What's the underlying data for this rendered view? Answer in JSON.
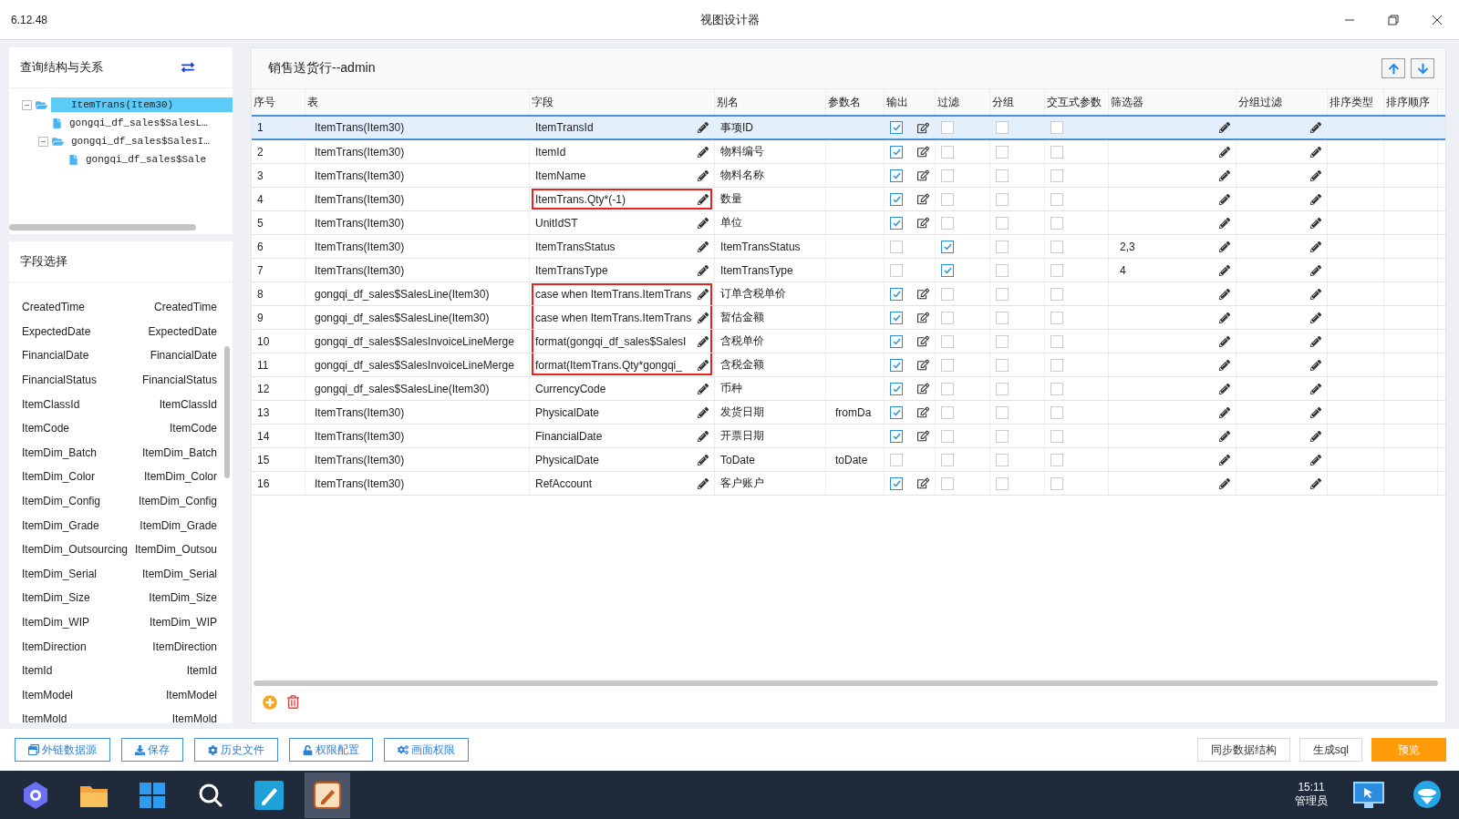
{
  "window": {
    "version": "6.12.48",
    "title": "视图设计器"
  },
  "structure": {
    "title": "查询结构与关系",
    "tree": [
      {
        "label": "ItemTrans(Item30)",
        "selected": true,
        "expanded": true,
        "kind": "folder",
        "children": [
          {
            "label": "gongqi_df_sales$SalesL…",
            "selected": false,
            "kind": "file"
          },
          {
            "label": "gongqi_df_sales$SalesI…",
            "selected": false,
            "expanded": true,
            "kind": "folder",
            "children": [
              {
                "label": "gongqi_df_sales$Sale",
                "selected": false,
                "kind": "file"
              }
            ]
          }
        ]
      }
    ]
  },
  "field_select": {
    "title": "字段选择",
    "fields": [
      {
        "name": "CreatedTime",
        "alias": "CreatedTime"
      },
      {
        "name": "ExpectedDate",
        "alias": "ExpectedDate"
      },
      {
        "name": "FinancialDate",
        "alias": "FinancialDate"
      },
      {
        "name": "FinancialStatus",
        "alias": "FinancialStatus"
      },
      {
        "name": "ItemClassId",
        "alias": "ItemClassId"
      },
      {
        "name": "ItemCode",
        "alias": "ItemCode"
      },
      {
        "name": "ItemDim_Batch",
        "alias": "ItemDim_Batch"
      },
      {
        "name": "ItemDim_Color",
        "alias": "ItemDim_Color"
      },
      {
        "name": "ItemDim_Config",
        "alias": "ItemDim_Config"
      },
      {
        "name": "ItemDim_Grade",
        "alias": "ItemDim_Grade"
      },
      {
        "name": "ItemDim_Outsourcing",
        "alias": "ItemDim_Outsou"
      },
      {
        "name": "ItemDim_Serial",
        "alias": "ItemDim_Serial"
      },
      {
        "name": "ItemDim_Size",
        "alias": "ItemDim_Size"
      },
      {
        "name": "ItemDim_WIP",
        "alias": "ItemDim_WIP"
      },
      {
        "name": "ItemDirection",
        "alias": "ItemDirection"
      },
      {
        "name": "ItemId",
        "alias": "ItemId"
      },
      {
        "name": "ItemModel",
        "alias": "ItemModel"
      },
      {
        "name": "ItemMold",
        "alias": "ItemMold"
      }
    ]
  },
  "grid": {
    "title": "销售送货行--admin",
    "columns": [
      "序号",
      "表",
      "字段",
      "别名",
      "参数名",
      "输出",
      "过滤",
      "分组",
      "交互式参数",
      "筛选器",
      "分组过滤",
      "排序类型",
      "排序顺序"
    ],
    "rows": [
      {
        "no": "1",
        "table": "ItemTrans(Item30)",
        "field": "ItemTransId",
        "highlighted": false,
        "alias": "事项ID",
        "param": "",
        "output": true,
        "filter": false,
        "group": false,
        "interactive": false,
        "filter_value": "",
        "selected": true
      },
      {
        "no": "2",
        "table": "ItemTrans(Item30)",
        "field": "ItemId",
        "highlighted": false,
        "alias": "物料编号",
        "param": "",
        "output": true,
        "filter": false,
        "group": false,
        "interactive": false,
        "filter_value": "",
        "selected": false
      },
      {
        "no": "3",
        "table": "ItemTrans(Item30)",
        "field": "ItemName",
        "highlighted": false,
        "alias": "物料名称",
        "param": "",
        "output": true,
        "filter": false,
        "group": false,
        "interactive": false,
        "filter_value": "",
        "selected": false
      },
      {
        "no": "4",
        "table": "ItemTrans(Item30)",
        "field": "ItemTrans.Qty*(-1)",
        "highlighted": true,
        "alias": "数量",
        "param": "",
        "output": true,
        "filter": false,
        "group": false,
        "interactive": false,
        "filter_value": "",
        "selected": false
      },
      {
        "no": "5",
        "table": "ItemTrans(Item30)",
        "field": "UnitIdST",
        "highlighted": false,
        "alias": "单位",
        "param": "",
        "output": true,
        "filter": false,
        "group": false,
        "interactive": false,
        "filter_value": "",
        "selected": false
      },
      {
        "no": "6",
        "table": "ItemTrans(Item30)",
        "field": "ItemTransStatus",
        "highlighted": false,
        "alias": "ItemTransStatus",
        "param": "",
        "output": false,
        "filter": true,
        "group": false,
        "interactive": false,
        "filter_value": "2,3",
        "selected": false
      },
      {
        "no": "7",
        "table": "ItemTrans(Item30)",
        "field": "ItemTransType",
        "highlighted": false,
        "alias": "ItemTransType",
        "param": "",
        "output": false,
        "filter": true,
        "group": false,
        "interactive": false,
        "filter_value": "4",
        "selected": false
      },
      {
        "no": "8",
        "table": "gongqi_df_sales$SalesLine(Item30)",
        "field": "case when ItemTrans.ItemTrans",
        "highlighted": true,
        "alias": "订单含税单价",
        "param": "",
        "output": true,
        "filter": false,
        "group": false,
        "interactive": false,
        "filter_value": "",
        "selected": false
      },
      {
        "no": "9",
        "table": "gongqi_df_sales$SalesLine(Item30)",
        "field": "case when ItemTrans.ItemTrans",
        "highlighted": true,
        "alias": "暂估金额",
        "param": "",
        "output": true,
        "filter": false,
        "group": false,
        "interactive": false,
        "filter_value": "",
        "selected": false
      },
      {
        "no": "10",
        "table": "gongqi_df_sales$SalesInvoiceLineMerge",
        "field": "format(gongqi_df_sales$SalesI",
        "highlighted": true,
        "alias": "含税单价",
        "param": "",
        "output": true,
        "filter": false,
        "group": false,
        "interactive": false,
        "filter_value": "",
        "selected": false
      },
      {
        "no": "11",
        "table": "gongqi_df_sales$SalesInvoiceLineMerge",
        "field": "format(ItemTrans.Qty*gongqi_",
        "highlighted": true,
        "alias": "含税金额",
        "param": "",
        "output": true,
        "filter": false,
        "group": false,
        "interactive": false,
        "filter_value": "",
        "selected": false
      },
      {
        "no": "12",
        "table": "gongqi_df_sales$SalesLine(Item30)",
        "field": "CurrencyCode",
        "highlighted": false,
        "alias": "币种",
        "param": "",
        "output": true,
        "filter": false,
        "group": false,
        "interactive": false,
        "filter_value": "",
        "selected": false
      },
      {
        "no": "13",
        "table": "ItemTrans(Item30)",
        "field": "PhysicalDate",
        "highlighted": false,
        "alias": "发货日期",
        "param": "fromDa",
        "output": true,
        "filter": false,
        "group": false,
        "interactive": false,
        "filter_value": "",
        "selected": false
      },
      {
        "no": "14",
        "table": "ItemTrans(Item30)",
        "field": "FinancialDate",
        "highlighted": false,
        "alias": "开票日期",
        "param": "",
        "output": true,
        "filter": false,
        "group": false,
        "interactive": false,
        "filter_value": "",
        "selected": false
      },
      {
        "no": "15",
        "table": "ItemTrans(Item30)",
        "field": "PhysicalDate",
        "highlighted": false,
        "alias": "ToDate",
        "param": "toDate",
        "output": false,
        "filter": false,
        "group": false,
        "interactive": false,
        "filter_value": "",
        "selected": false
      },
      {
        "no": "16",
        "table": "ItemTrans(Item30)",
        "field": "RefAccount",
        "highlighted": false,
        "alias": "客户账户",
        "param": "",
        "output": true,
        "filter": false,
        "group": false,
        "interactive": false,
        "filter_value": "",
        "selected": false
      }
    ]
  },
  "toolbar_left": [
    {
      "label": "外链数据源",
      "kind": "link"
    },
    {
      "label": "保存",
      "kind": "save"
    },
    {
      "label": "历史文件",
      "kind": "gear"
    },
    {
      "label": "权限配置",
      "kind": "lock"
    },
    {
      "label": "画面权限",
      "kind": "gears"
    }
  ],
  "toolbar_right": [
    {
      "label": "同步数据结构",
      "primary": false
    },
    {
      "label": "生成sql",
      "primary": false
    },
    {
      "label": "预览",
      "primary": true
    }
  ],
  "taskbar": {
    "time": "15:11",
    "user": "管理员"
  }
}
